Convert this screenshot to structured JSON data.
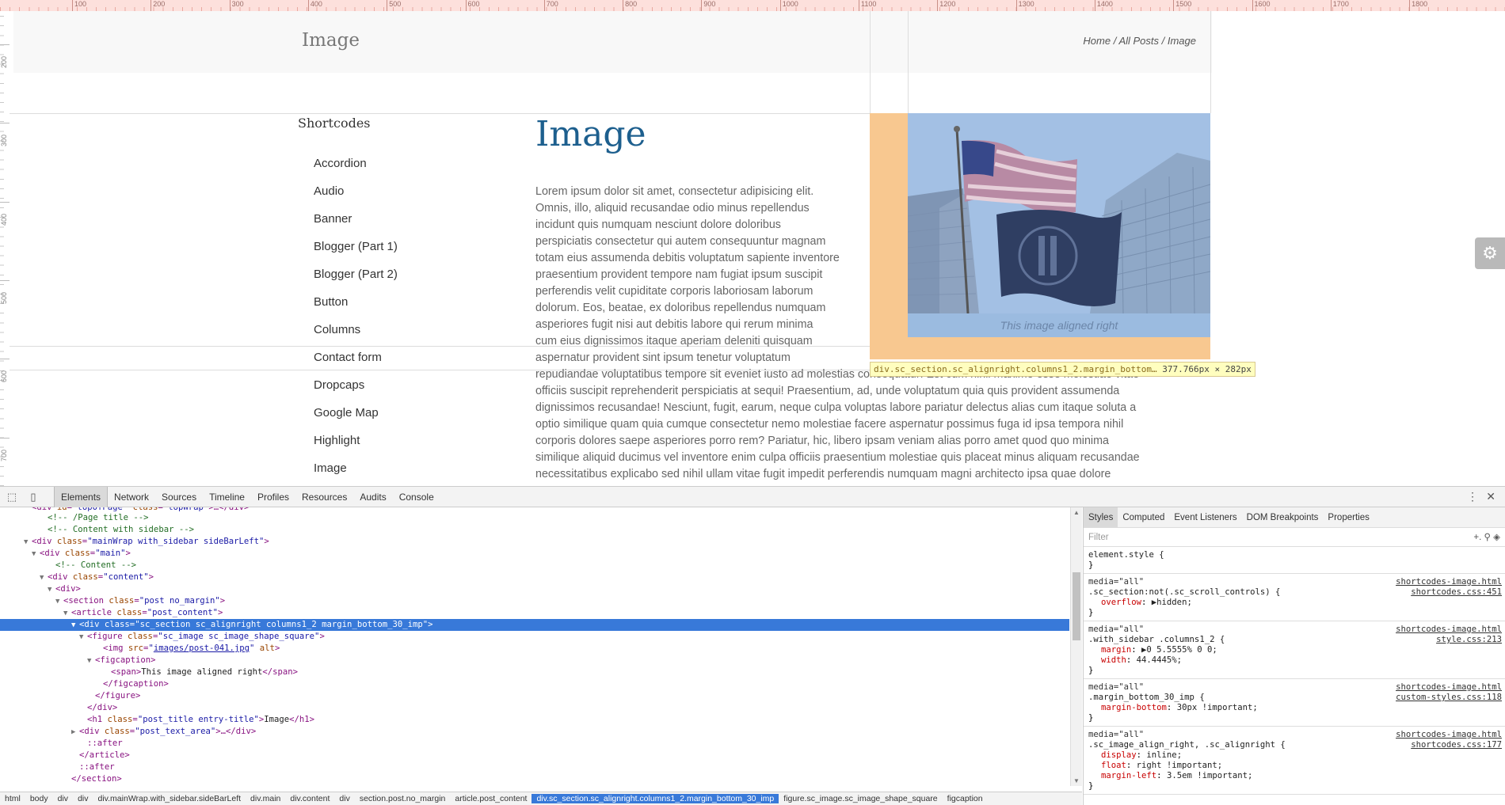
{
  "ruler": {
    "top_ticks": [
      "100",
      "200",
      "300",
      "400",
      "500",
      "600",
      "700",
      "800",
      "900",
      "1000",
      "1100",
      "1200",
      "1300",
      "1400",
      "1500",
      "1600",
      "1700",
      "1800"
    ],
    "left_ticks": [
      "200",
      "300",
      "400",
      "500",
      "600",
      "700"
    ]
  },
  "page": {
    "header_title": "Image",
    "breadcrumb": "Home / All Posts / Image",
    "sidebar_title": "Shortcodes",
    "sidebar_items": [
      "Accordion",
      "Audio",
      "Banner",
      "Blogger (Part 1)",
      "Blogger (Part 2)",
      "Button",
      "Columns",
      "Contact form",
      "Dropcaps",
      "Google Map",
      "Highlight",
      "Image"
    ],
    "post_title": "Image",
    "post_text_narrow": [
      "Lorem ipsum dolor sit amet, consectetur adipisicing elit.",
      "Omnis, illo, aliquid recusandae odio minus repellendus",
      "incidunt quis numquam nesciunt dolore doloribus",
      "perspiciatis consectetur qui autem consequuntur magnam",
      "totam eius assumenda debitis voluptatum sapiente inventore",
      "praesentium provident tempore nam fugiat ipsum suscipit",
      "perferendis velit cupiditate corporis laboriosam laborum",
      "dolorum. Eos, beatae, ex doloribus repellendus numquam",
      "asperiores fugit nisi aut debitis labore qui rerum minima",
      "cum eius dignissimos itaque aperiam deleniti quisquam",
      "aspernatur provident sint ipsum tenetur voluptatum"
    ],
    "post_text_wide": [
      "repudiandae voluptatibus tempore sit eveniet iusto ad molestias consequatur! Est cum nihil maxime esse molestiae vitae",
      "officiis suscipit reprehenderit perspiciatis at sequi! Praesentium, ad, unde voluptatum quia quis provident assumenda",
      "dignissimos recusandae! Nesciunt, fugit, earum, neque culpa voluptas labore pariatur delectus alias cum itaque soluta a",
      "optio similique quam quia cumque consectetur nemo molestiae facere aspernatur possimus fuga id ipsa tempora nihil",
      "corporis dolores saepe asperiores porro rem? Pariatur, hic, libero ipsam veniam alias porro amet quod quo minima",
      "similique aliquid ducimus vel inventore enim culpa officiis praesentium molestiae quis placeat minus aliquam recusandae",
      "necessitatibus explicabo sed nihil ullam vitae fugit impedit perferendis numquam magni architecto ipsa quae dolore"
    ],
    "figure_caption": "This image aligned right",
    "tooltip_selector": "div.sc_section.sc_alignright.columns1_2.margin_bottom…",
    "tooltip_dims": "377.766px × 282px",
    "settings_icon": "gear-icon"
  },
  "devtools": {
    "tabs": [
      "Elements",
      "Network",
      "Sources",
      "Timeline",
      "Profiles",
      "Resources",
      "Audits",
      "Console"
    ],
    "active_tab": "Elements",
    "dom_lines": [
      {
        "indent": 6,
        "arrow": "",
        "html": "<span class='cmt'>&lt;!-- /Page title --&gt;</span>"
      },
      {
        "indent": 6,
        "arrow": "",
        "html": "<span class='cmt'>&lt;!-- Content with sidebar --&gt;</span>"
      },
      {
        "indent": 4,
        "arrow": "▼",
        "html": "<span class='tag'>&lt;div</span> <span class='attr'>class</span>=<span class='val'>\"mainWrap with_sidebar sideBarLeft\"</span><span class='tag'>&gt;</span>"
      },
      {
        "indent": 5,
        "arrow": "▼",
        "html": "<span class='tag'>&lt;div</span> <span class='attr'>class</span>=<span class='val'>\"main\"</span><span class='tag'>&gt;</span>"
      },
      {
        "indent": 7,
        "arrow": "",
        "html": "<span class='cmt'>&lt;!-- Content --&gt;</span>"
      },
      {
        "indent": 6,
        "arrow": "▼",
        "html": "<span class='tag'>&lt;div</span> <span class='attr'>class</span>=<span class='val'>\"content\"</span><span class='tag'>&gt;</span>"
      },
      {
        "indent": 7,
        "arrow": "▼",
        "html": "<span class='tag'>&lt;div&gt;</span>"
      },
      {
        "indent": 8,
        "arrow": "▼",
        "html": "<span class='tag'>&lt;section</span> <span class='attr'>class</span>=<span class='val'>\"post no_margin\"</span><span class='tag'>&gt;</span>"
      },
      {
        "indent": 9,
        "arrow": "▼",
        "html": "<span class='tag'>&lt;article</span> <span class='attr'>class</span>=<span class='val'>\"post_content\"</span><span class='tag'>&gt;</span>"
      },
      {
        "indent": 10,
        "arrow": "▼",
        "html": "<span class='tag'>&lt;div</span> <span class='attr'>class</span>=<span class='val'>\"sc_section sc_alignright columns1_2 margin_bottom_30_imp\"</span><span class='tag'>&gt;</span>",
        "selected": true
      },
      {
        "indent": 11,
        "arrow": "▼",
        "html": "<span class='tag'>&lt;figure</span> <span class='attr'>class</span>=<span class='val'>\"sc_image  sc_image_shape_square\"</span><span class='tag'>&gt;</span>"
      },
      {
        "indent": 13,
        "arrow": "",
        "html": "<span class='tag'>&lt;img</span> <span class='attr'>src</span>=<span class='val'>\"<span class='link'>images/post-041.jpg</span>\"</span> <span class='attr'>alt</span><span class='tag'>&gt;</span>"
      },
      {
        "indent": 12,
        "arrow": "▼",
        "html": "<span class='tag'>&lt;figcaption&gt;</span>"
      },
      {
        "indent": 14,
        "arrow": "",
        "html": "<span class='tag'>&lt;span&gt;</span><span class='txt'>This image aligned right</span><span class='tag'>&lt;/span&gt;</span>"
      },
      {
        "indent": 13,
        "arrow": "",
        "html": "<span class='tag'>&lt;/figcaption&gt;</span>"
      },
      {
        "indent": 12,
        "arrow": "",
        "html": "<span class='tag'>&lt;/figure&gt;</span>"
      },
      {
        "indent": 11,
        "arrow": "",
        "html": "<span class='tag'>&lt;/div&gt;</span>"
      },
      {
        "indent": 11,
        "arrow": "",
        "html": "<span class='tag'>&lt;h1</span> <span class='attr'>class</span>=<span class='val'>\"post_title entry-title\"</span><span class='tag'>&gt;</span><span class='txt'>Image</span><span class='tag'>&lt;/h1&gt;</span>"
      },
      {
        "indent": 10,
        "arrow": "▶",
        "html": "<span class='tag'>&lt;div</span> <span class='attr'>class</span>=<span class='val'>\"post_text_area\"</span><span class='tag'>&gt;</span>…<span class='tag'>&lt;/div&gt;</span>"
      },
      {
        "indent": 11,
        "arrow": "",
        "html": "<span class='tag'>::after</span>"
      },
      {
        "indent": 10,
        "arrow": "",
        "html": "<span class='tag'>&lt;/article&gt;</span>"
      },
      {
        "indent": 10,
        "arrow": "",
        "html": "<span class='tag'>::after</span>"
      },
      {
        "indent": 9,
        "arrow": "",
        "html": "<span class='tag'>&lt;/section&gt;</span>"
      }
    ],
    "breadcrumbs": [
      "html",
      "body",
      "div",
      "div",
      "div.mainWrap.with_sidebar.sideBarLeft",
      "div.main",
      "div.content",
      "div",
      "section.post.no_margin",
      "article.post_content",
      "div.sc_section.sc_alignright.columns1_2.margin_bottom_30_imp",
      "figure.sc_image.sc_image_shape_square",
      "figcaption"
    ],
    "current_breadcrumb": "div.sc_section.sc_alignright.columns1_2.margin_bottom_30_imp",
    "styles_tabs": [
      "Styles",
      "Computed",
      "Event Listeners",
      "DOM Breakpoints",
      "Properties"
    ],
    "styles_active": "Styles",
    "filter_placeholder": "Filter",
    "rules": [
      {
        "media": "",
        "selector": "element.style {",
        "src1": "",
        "src2": "",
        "props": []
      },
      {
        "media": "media=\"all\"",
        "selector": ".sc_section:not(.sc_scroll_controls) {",
        "src1": "shortcodes-image.html",
        "src2": "shortcodes.css:451",
        "props": [
          [
            "overflow",
            "▶hidden;"
          ]
        ]
      },
      {
        "media": "media=\"all\"",
        "selector": ".with_sidebar .columns1_2 {",
        "src1": "shortcodes-image.html",
        "src2": "style.css:213",
        "props": [
          [
            "margin",
            "▶0 5.5555% 0 0;"
          ],
          [
            "width",
            "44.4445%;"
          ]
        ]
      },
      {
        "media": "media=\"all\"",
        "selector": ".margin_bottom_30_imp {",
        "src1": "shortcodes-image.html",
        "src2": "custom-styles.css:118",
        "props": [
          [
            "margin-bottom",
            "30px !important;"
          ]
        ]
      },
      {
        "media": "media=\"all\"",
        "selector": ".sc_image_align_right, .sc_alignright {",
        "src1": "shortcodes-image.html",
        "src2": "shortcodes.css:177",
        "props": [
          [
            "display",
            "inline;"
          ],
          [
            "float",
            "right !important;"
          ],
          [
            "margin-left",
            "3.5em !important;"
          ]
        ]
      }
    ]
  }
}
